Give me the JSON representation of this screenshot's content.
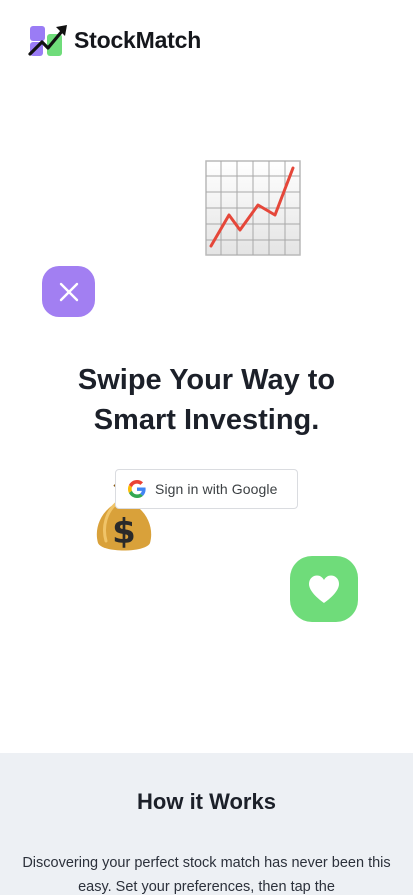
{
  "header": {
    "brand": "StockMatch"
  },
  "hero": {
    "headline_line1": "Swipe Your Way to",
    "headline_line2": "Smart Investing.",
    "google_button_label": "Sign in with Google",
    "icons": [
      "chart-increasing-emoji",
      "money-bag-emoji",
      "close-icon",
      "heart-icon"
    ]
  },
  "how_it_works": {
    "title": "How it Works",
    "text": "Discovering your perfect stock match has never been this easy. Set your preferences, then tap the"
  },
  "colors": {
    "purple": "#a27ff2",
    "green": "#6fdc7a",
    "section_bg": "#edf0f4"
  }
}
